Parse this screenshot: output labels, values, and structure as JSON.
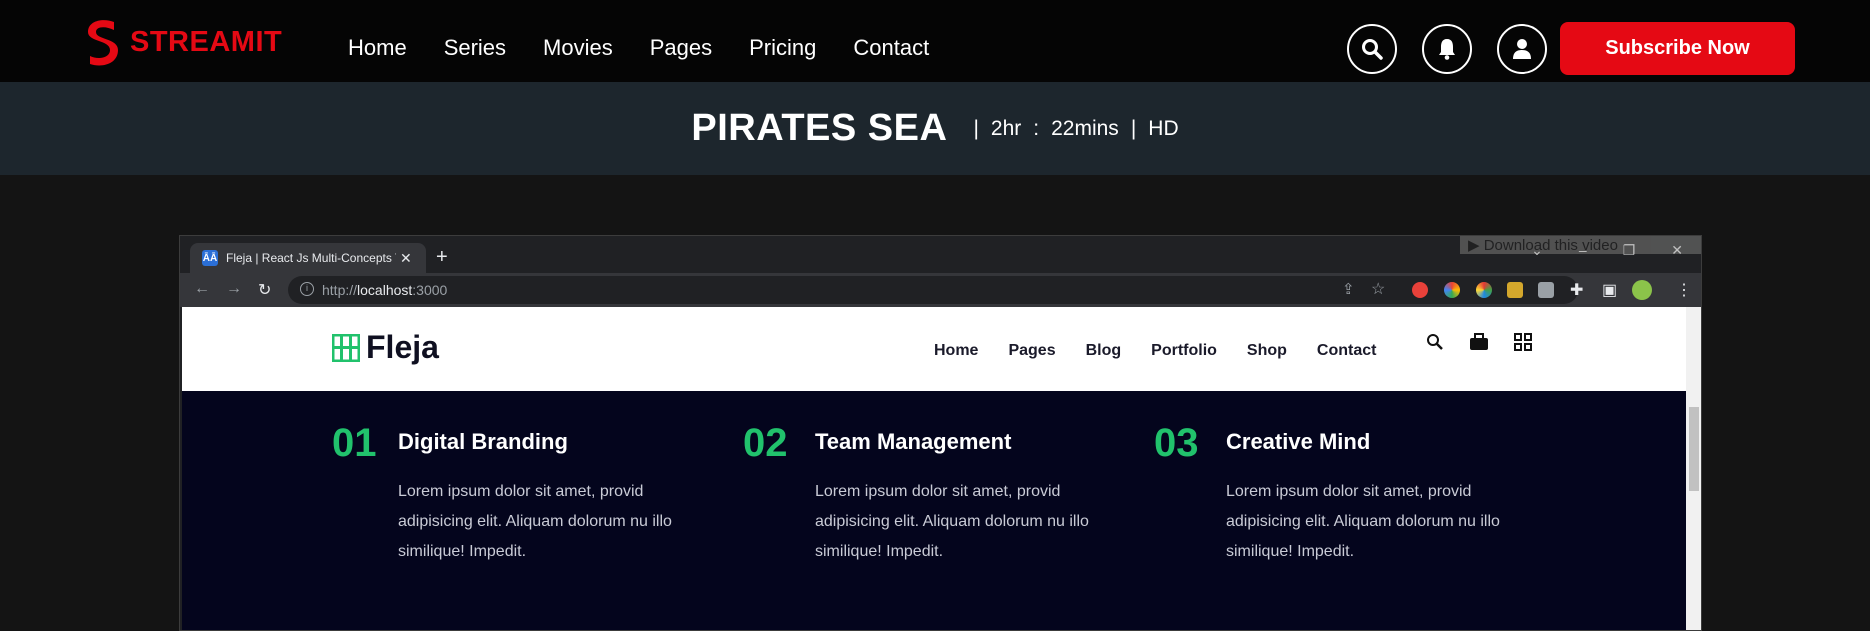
{
  "site": {
    "brand": "STREAMIT",
    "brand_color": "#e50914",
    "nav": [
      "Home",
      "Series",
      "Movies",
      "Pages",
      "Pricing",
      "Contact"
    ],
    "icons": [
      "search-icon",
      "bell-icon",
      "user-icon"
    ],
    "subscribe_label": "Subscribe Now"
  },
  "movie": {
    "title": "PIRATES SEA",
    "hours": "2hr",
    "colon": ":",
    "mins": "22mins",
    "quality": "HD",
    "sep": "|"
  },
  "video": {
    "download_label": "▶ Download this video",
    "browser": {
      "tab_icon": "ĀĀ",
      "tab_title": "Fleja | React Js Multi-Concepts Te",
      "url_scheme": "http://",
      "url_host": "localhost",
      "url_port": ":3000"
    },
    "page": {
      "logo": "Fleja",
      "accent_color": "#21c26c",
      "nav": [
        "Home",
        "Pages",
        "Blog",
        "Portfolio",
        "Shop",
        "Contact"
      ],
      "features": [
        {
          "num": "01",
          "title": "Digital Branding",
          "desc": "Lorem ipsum dolor sit amet, provid adipisicing elit. Aliquam dolorum nu illo similique! Impedit."
        },
        {
          "num": "02",
          "title": "Team Management",
          "desc": "Lorem ipsum dolor sit amet, provid adipisicing elit. Aliquam dolorum nu illo similique! Impedit."
        },
        {
          "num": "03",
          "title": "Creative Mind",
          "desc": "Lorem ipsum dolor sit amet, provid adipisicing elit. Aliquam dolorum nu illo similique! Impedit."
        }
      ]
    }
  }
}
